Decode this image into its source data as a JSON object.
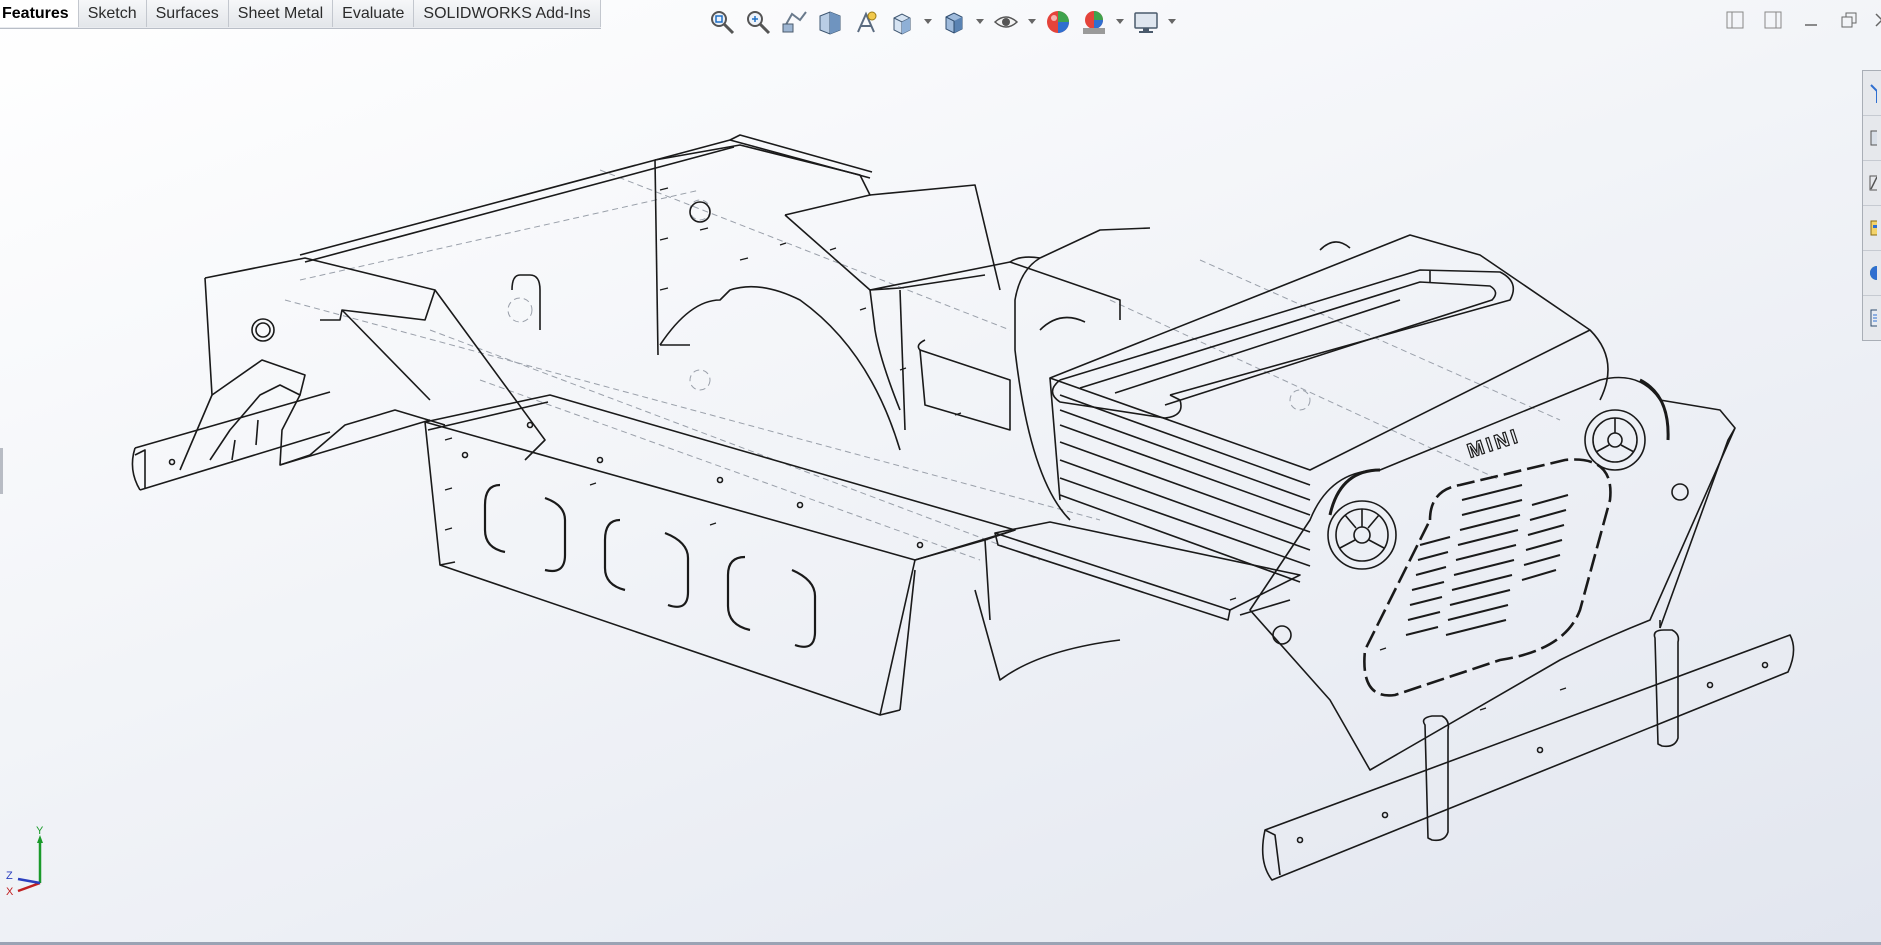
{
  "tabs": [
    {
      "label": "Features",
      "active": true
    },
    {
      "label": "Sketch"
    },
    {
      "label": "Surfaces"
    },
    {
      "label": "Sheet Metal"
    },
    {
      "label": "Evaluate"
    },
    {
      "label": "SOLIDWORKS Add-Ins"
    }
  ],
  "hud_icons": [
    "zoom-to-fit-icon",
    "zoom-to-area-icon",
    "previous-view-icon",
    "section-view-icon",
    "dynamic-annotation-icon",
    "view-orientation-icon",
    "display-style-icon",
    "hide-show-items-icon",
    "edit-appearance-icon",
    "apply-scene-icon",
    "view-settings-icon"
  ],
  "model": {
    "grille_text": "MINI"
  },
  "triad": {
    "x": "X",
    "y": "Y",
    "z": "Z"
  },
  "colors": {
    "accent": "#1f6fc5",
    "tab_bg": "#e9ebef",
    "line": "#1a1a1a"
  }
}
